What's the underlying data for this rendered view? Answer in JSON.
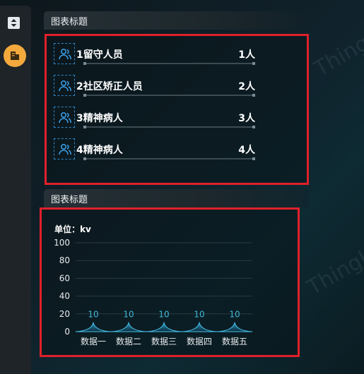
{
  "panel1": {
    "title": "图表标题",
    "items": [
      {
        "label": "1留守人员",
        "value": "1人"
      },
      {
        "label": "2社区矫正人员",
        "value": "2人"
      },
      {
        "label": "3精神病人",
        "value": "3人"
      },
      {
        "label": "4精神病人",
        "value": "4人"
      }
    ]
  },
  "panel2": {
    "title": "图表标题",
    "unit": "单位：kv"
  },
  "watermark": "ThingJS",
  "colors": {
    "frame_highlight": "#e0202a",
    "series": "#2fa6d6",
    "sidebar_accent": "#f4a93d"
  },
  "icons": {
    "sidebar_toggle": "expand-collapse-icon",
    "sidebar_active": "building-icon",
    "row_icon": "people-icon"
  },
  "chart_data": {
    "type": "area",
    "categories": [
      "数据一",
      "数据二",
      "数据三",
      "数据四",
      "数据五"
    ],
    "series": [
      {
        "values": [
          10,
          10,
          10,
          10,
          10
        ]
      }
    ],
    "data_labels": [
      "10",
      "10",
      "10",
      "10",
      "10"
    ],
    "yticks": [
      "0",
      "20",
      "40",
      "60",
      "80",
      "100"
    ],
    "ylim": [
      0,
      100
    ],
    "title": "",
    "ylabel": "单位：kv",
    "grid": true
  }
}
